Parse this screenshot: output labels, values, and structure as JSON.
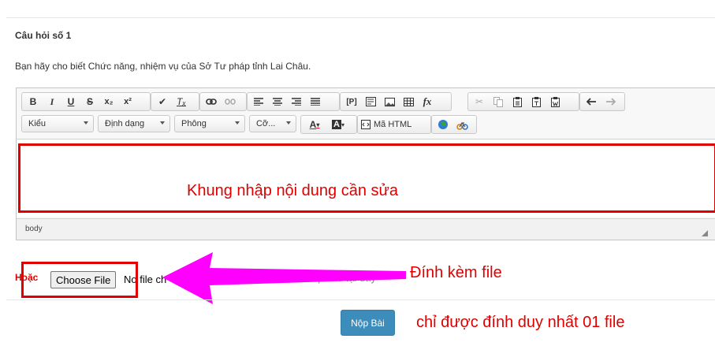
{
  "question": {
    "title": "Câu hỏi số 1",
    "text": "Bạn hãy cho biết Chức năng, nhiệm vụ của Sở Tư pháp tỉnh Lai Châu."
  },
  "editor": {
    "toolbar_row1": {
      "bold": "B",
      "italic": "I",
      "underline": "U",
      "strike": "S",
      "subscript": "x₂",
      "superscript": "x²",
      "remove_format": "Tₓ",
      "formula": "fx",
      "paragraph_tag": "[P]"
    },
    "toolbar_row2": {
      "style": "Kiểu",
      "format": "Định dạng",
      "font": "Phông",
      "size": "Cỡ...",
      "text_color": "A",
      "bg_color": "A",
      "source": "Mã HTML"
    },
    "status_path": "body",
    "annotation": "Khung nhập nội dung cần sửa"
  },
  "attachment": {
    "or_label": "Hoặc",
    "choose_file": "Choose File",
    "no_file": "No file ch",
    "upload_hint": "upload tại đây",
    "annotation": "Đính kèm file"
  },
  "submit": {
    "label": "Nộp Bài",
    "annotation": "chỉ được đính duy nhất 01 file"
  },
  "colors": {
    "annotation_red": "#e00000",
    "arrow_magenta": "#ff00ff",
    "submit_blue": "#3c8dbc"
  }
}
